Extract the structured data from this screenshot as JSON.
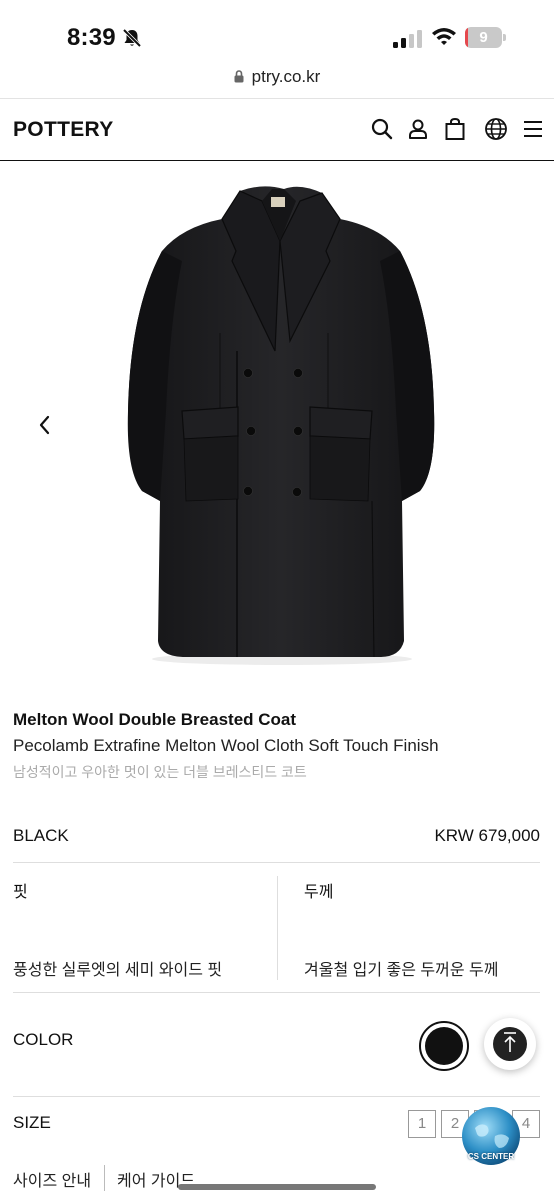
{
  "status": {
    "time": "8:39",
    "battery": "9",
    "battery_level": 0.09
  },
  "browser": {
    "url": "ptry.co.kr"
  },
  "header": {
    "logo": "POTTERY",
    "icons": [
      "search-icon",
      "user-icon",
      "bag-icon",
      "globe-icon",
      "menu-icon"
    ]
  },
  "product": {
    "name": "Melton Wool Double Breasted Coat",
    "subtitle": "Pecolamb Extrafine Melton Wool Cloth Soft Touch Finish",
    "description": "남성적이고 우아한 멋이 있는 더블 브레스티드 코트",
    "color_name": "BLACK",
    "price": "KRW 679,000",
    "coat_color": "#1c1c1e"
  },
  "specs": [
    {
      "label": "핏",
      "value": "풍성한 실루엣의 세미 와이드 핏"
    },
    {
      "label": "두께",
      "value": "겨울철 입기 좋은 두꺼운 두께"
    }
  ],
  "color_section": {
    "label": "COLOR",
    "swatch": "#111111"
  },
  "size_section": {
    "label": "SIZE",
    "sizes": [
      "1",
      "2",
      "3",
      "4"
    ]
  },
  "bottom_links": {
    "size_guide": "사이즈 안내",
    "care_guide": "케어 가이드"
  },
  "cs_badge": {
    "label": "CS CENTER"
  }
}
